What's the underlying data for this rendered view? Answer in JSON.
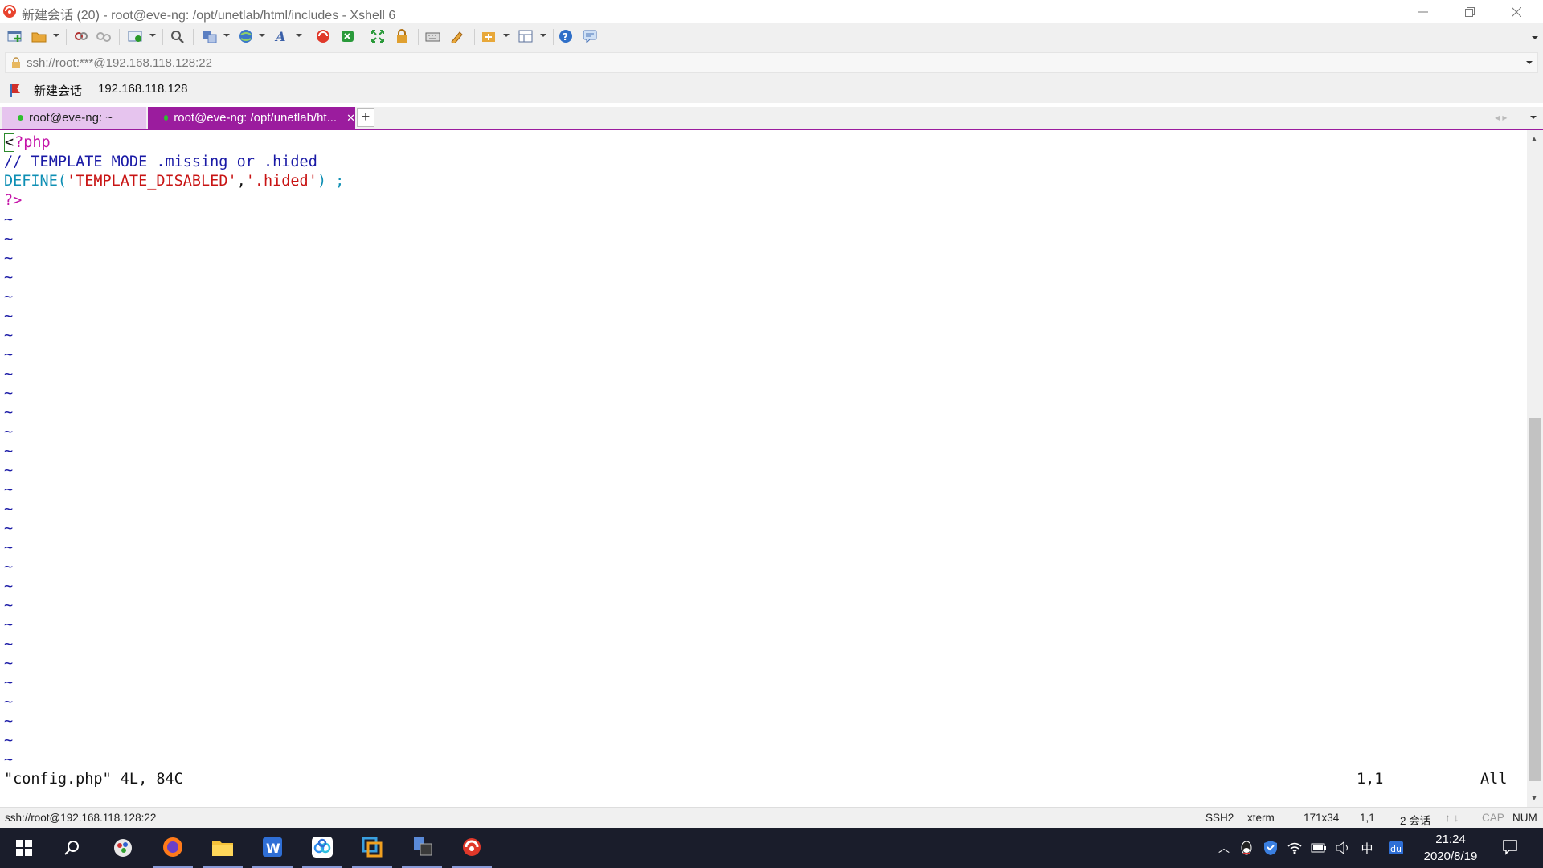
{
  "window": {
    "title": "新建会话 (20) - root@eve-ng: /opt/unetlab/html/includes - Xshell 6",
    "minimize_icon": "minimize-icon",
    "restore_icon": "restore-icon",
    "close_icon": "close-icon"
  },
  "toolbar": {
    "icons": [
      "new-session-icon",
      "open-folder-icon",
      "connect-icon",
      "disconnect-icon",
      "new-tab-icon",
      "find-icon",
      "transfer-icon",
      "globe-icon",
      "font-icon",
      "xshell-icon",
      "xftp-icon",
      "fullscreen-icon",
      "lock-icon",
      "keyboard-icon",
      "script-icon",
      "compose-icon",
      "layout-icon",
      "help-icon",
      "chat-icon"
    ]
  },
  "address": {
    "value": "ssh://root:***@192.168.118.128:22"
  },
  "session_bar": {
    "name": "新建会话",
    "host": "192.168.118.128"
  },
  "tabs": [
    {
      "label": "root@eve-ng: ~",
      "active": false
    },
    {
      "label": "root@eve-ng: /opt/unetlab/ht...",
      "active": true
    }
  ],
  "add_tab_label": "+",
  "terminal": {
    "line1_cursor": "<",
    "line1_rest": "?php",
    "line2": "// TEMPLATE MODE .missing or .hided",
    "line3_func": "DEFINE(",
    "line3_arg1": "'TEMPLATE_DISABLED'",
    "line3_comma": ",",
    "line3_arg2": "'.hided'",
    "line3_end": ") ;",
    "line4": "?>",
    "tilde": "~",
    "status_file": "\"config.php\" 4L, 84C",
    "status_pos": "1,1",
    "status_all": "All"
  },
  "statusbar": {
    "connection": "ssh://root@192.168.118.128:22",
    "protocol": "SSH2",
    "term": "xterm",
    "size": "171x34",
    "cursor": "1,1",
    "sessions": "2 会话",
    "cap": "CAP",
    "num": "NUM"
  },
  "taskbar": {
    "time": "21:24",
    "date": "2020/8/19",
    "ime": "中"
  }
}
